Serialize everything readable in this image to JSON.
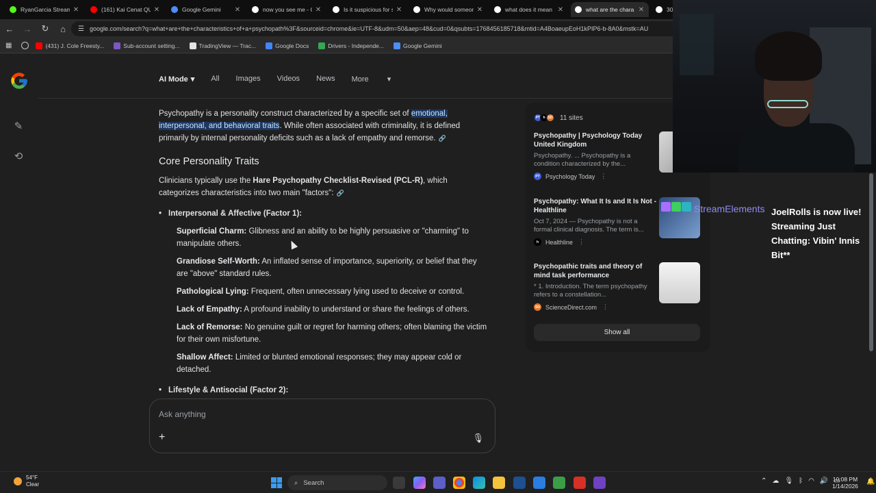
{
  "browser": {
    "tabs": [
      {
        "label": "RyanGarcia Stream",
        "icon": "kick-icon",
        "color": "#53fc18"
      },
      {
        "label": "(161) Kai Cenat QU",
        "icon": "youtube-icon",
        "color": "#ff0000"
      },
      {
        "label": "Google Gemini",
        "icon": "gemini-icon",
        "color": "#4c8df6"
      },
      {
        "label": "now you see me - C",
        "icon": "google-icon",
        "color": "#ffffff"
      },
      {
        "label": "Is it suspicious for s",
        "icon": "google-icon",
        "color": "#ffffff"
      },
      {
        "label": "Why would someon",
        "icon": "google-icon",
        "color": "#ffffff"
      },
      {
        "label": "what does it mean",
        "icon": "google-icon",
        "color": "#ffffff"
      },
      {
        "label": "what are the chara",
        "icon": "google-icon",
        "color": "#ffffff",
        "active": true
      },
      {
        "label": "30 x",
        "icon": "google-icon",
        "color": "#ffffff"
      }
    ],
    "url": "google.com/search?q=what+are+the+characteristics+of+a+psychopath%3F&sourceid=chrome&ie=UTF-8&udm=50&aep=48&cud=0&qsubts=1768456185718&mtid=A4BoaeupEoH1kPIP6-b-8A0&mstk=AU",
    "bookmarks": [
      {
        "label": "(431) J. Cole Freesty...",
        "icon": "youtube-icon",
        "color": "#ff0000"
      },
      {
        "label": "Sub-account setting...",
        "icon": "account-icon",
        "color": "#7e57c2"
      },
      {
        "label": "TradingView — Trac...",
        "icon": "tradingview-icon",
        "color": "#e3e3e3"
      },
      {
        "label": "Google Docs",
        "icon": "docs-icon",
        "color": "#4285f4"
      },
      {
        "label": "Drivers - Independe...",
        "icon": "drivers-icon",
        "color": "#34a853"
      },
      {
        "label": "Google Gemini",
        "icon": "gemini-icon",
        "color": "#4c8df6"
      }
    ]
  },
  "search_nav": {
    "ai_mode": "AI Mode",
    "tabs": [
      "All",
      "Images",
      "Videos",
      "News",
      "More"
    ]
  },
  "answer": {
    "intro_pre": "Psychopathy is a personality construct characterized by a specific set of ",
    "intro_hl": "emotional, interpersonal, and behavioral traits",
    "intro_post": ". While often associated with criminality, it is defined primarily by internal personality deficits such as a lack of empathy and remorse.",
    "heading": "Core Personality Traits",
    "p2_pre": "Clinicians typically use the ",
    "p2_bold": "Hare Psychopathy Checklist-Revised (PCL-R)",
    "p2_post": ", which categorizes characteristics into two main \"factors\":",
    "factor1": "Interpersonal & Affective (Factor 1):",
    "traits": [
      {
        "name": "Superficial Charm:",
        "desc": " Glibness and an ability to be highly persuasive or \"charming\" to manipulate others."
      },
      {
        "name": "Grandiose Self-Worth:",
        "desc": " An inflated sense of importance, superiority, or belief that they are \"above\" standard rules."
      },
      {
        "name": "Pathological Lying:",
        "desc": " Frequent, often unnecessary lying used to deceive or control."
      },
      {
        "name": "Lack of Empathy:",
        "desc": " A profound inability to understand or share the feelings of others."
      },
      {
        "name": "Lack of Remorse:",
        "desc": " No genuine guilt or regret for harming others; often blaming the victim for their own misfortune."
      },
      {
        "name": "Shallow Affect:",
        "desc": " Limited or blunted emotional responses; they may appear cold or detached."
      }
    ],
    "factor2": "Lifestyle & Antisocial (Factor 2):"
  },
  "ask": {
    "placeholder": "Ask anything"
  },
  "sources": {
    "count_label": "11 sites",
    "items": [
      {
        "title": "Psychopathy | Psychology Today United Kingdom",
        "snippet": "Psychopathy. ... Psychopathy is a condition characterized by the...",
        "site": "Psychology Today",
        "fav": "PT",
        "fav_color": "#3b5bdb"
      },
      {
        "title": "Psychopathy: What It Is and It Is Not - Healthline",
        "snippet": "Oct 7, 2024 — Psychopathy is not a formal clinical diagnosis. The term is...",
        "site": "Healthline",
        "fav": "h",
        "fav_color": "#000000"
      },
      {
        "title": "Psychopathic traits and theory of mind task performance",
        "snippet": "* 1. Introduction. The term psychopathy refers to a constellation...",
        "site": "ScienceDirect.com",
        "fav": "SD",
        "fav_color": "#e0772a"
      }
    ],
    "show_all": "Show all"
  },
  "overlay": {
    "streamelements": "StreamElements",
    "live_text": "JoelRolls is now live! Streaming Just Chatting: Vibin' Innis Bit**"
  },
  "taskbar": {
    "temp": "54°F",
    "condition": "Clear",
    "search": "Search",
    "time": "10:08 PM",
    "date": "1/14/2026"
  }
}
